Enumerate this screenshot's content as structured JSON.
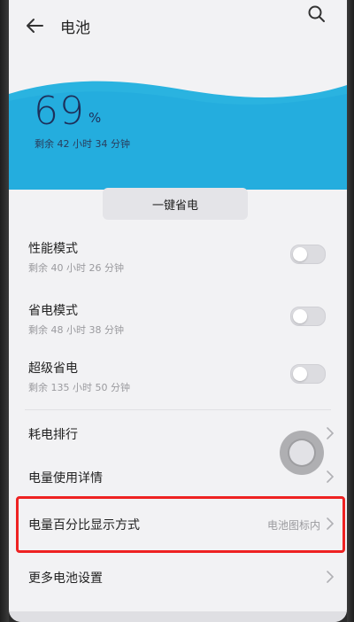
{
  "header": {
    "title": "电池",
    "back_icon": "arrow-left-icon",
    "search_icon": "search-icon"
  },
  "battery": {
    "percent": "69",
    "percent_sign": "%",
    "remaining": "剩余 42 小时 34 分钟",
    "wave_color": "#2ab3e0"
  },
  "one_tap_save": {
    "label": "一键省电"
  },
  "modes": [
    {
      "title": "性能模式",
      "subtitle": "剩余 40 小时 26 分钟",
      "enabled": false
    },
    {
      "title": "省电模式",
      "subtitle": "剩余 48 小时 38 分钟",
      "enabled": false
    },
    {
      "title": "超级省电",
      "subtitle": "剩余 135 小时 50 分钟",
      "enabled": false
    }
  ],
  "nav_items": [
    {
      "label": "耗电排行",
      "value": ""
    },
    {
      "label": "电量使用详情",
      "value": ""
    },
    {
      "label": "电量百分比显示方式",
      "value": "电池图标内"
    },
    {
      "label": "更多电池设置",
      "value": ""
    }
  ],
  "colors": {
    "highlight": "#ee2222",
    "accent": "#2ab3e0"
  }
}
